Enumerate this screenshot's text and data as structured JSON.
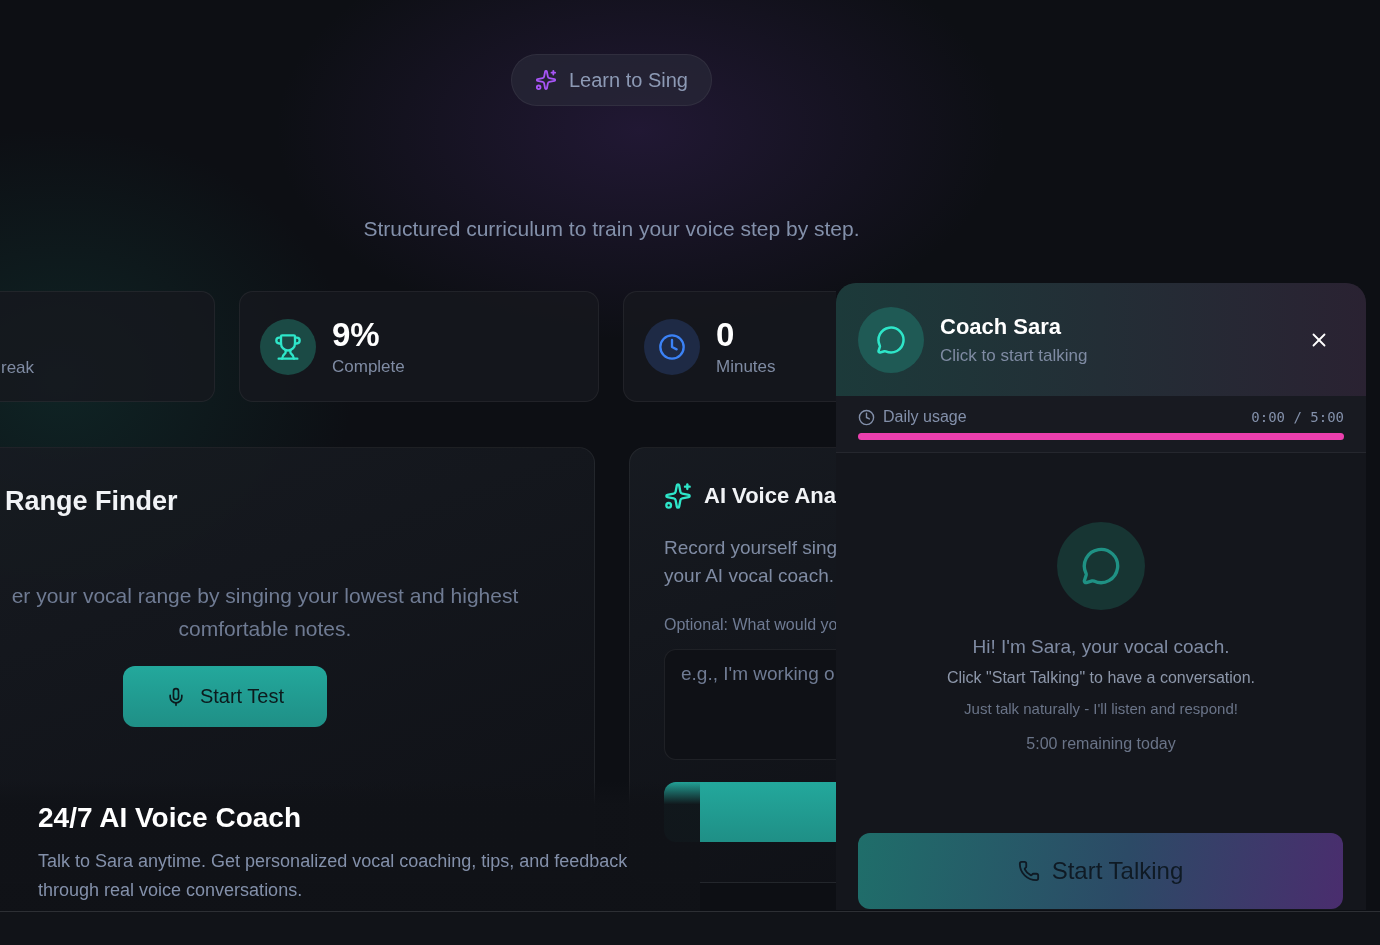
{
  "badge": {
    "label": "Learn to Sing"
  },
  "subtitle": "Structured curriculum to train your voice step by step.",
  "stats": [
    {
      "label": "reak"
    },
    {
      "kind": "trophy",
      "value": "9%",
      "label": "Complete"
    },
    {
      "kind": "clock",
      "value": "0",
      "label": "Minutes"
    }
  ],
  "range_finder": {
    "title": "Range Finder",
    "description": "er your vocal range by singing your lowest and highest comfortable notes.",
    "button": "Start Test"
  },
  "voice_analysis": {
    "title": "AI Voice Ana",
    "description_lines": [
      "Record yourself sing",
      "your AI vocal coach."
    ],
    "field_label": "Optional: What would yo",
    "placeholder": "e.g., I'm working o"
  },
  "coach_promo": {
    "title": "24/7 AI Voice Coach",
    "description": "Talk to Sara anytime. Get personalized vocal coaching, tips, and feedback through real voice conversations."
  },
  "chat_panel": {
    "name": "Coach Sara",
    "status": "Click to start talking",
    "usage": {
      "label": "Daily usage",
      "reading": "0:00 / 5:00",
      "level": 1
    },
    "greeting": "Hi! I'm Sara, your vocal coach.",
    "instructions": [
      "Click \"Start Talking\" to have a conversation.",
      "Just talk naturally - I'll listen and respond!"
    ],
    "remaining": "5:00 remaining today",
    "button": "Start Talking"
  }
}
